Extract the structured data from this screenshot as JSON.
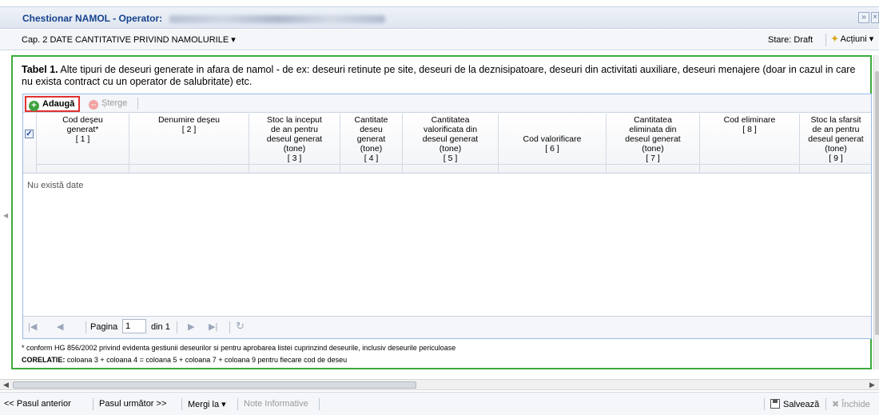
{
  "window": {
    "title_label": "Chestionar NAMOL - Operator:",
    "controls": {
      "collapse_icon": "double-chevron-up-icon",
      "close_icon": "close-icon"
    }
  },
  "chapter_bar": {
    "chapter_label": "Cap. 2 DATE CANTITATIVE PRIVIND NAMOLURILE ▾",
    "status_text": "Stare: Draft",
    "actions_label": "Acțiuni ▾"
  },
  "table": {
    "title_bold": "Tabel 1.",
    "title_text": " Alte tipuri de deseuri generate in afara de namol - de ex: deseuri retinute pe site, deseuri de la deznisipatoare, deseuri din activitati auxiliare, deseuri menajere (doar in cazul in care nu exista contract cu un operator de salubritate) etc.",
    "toolbar": {
      "add_label": "Adaugă",
      "delete_label": "Șterge"
    },
    "columns": [
      {
        "label": "Cod deşeu\ngenerat*",
        "num": "[ 1 ]"
      },
      {
        "label": "Denumire deşeu",
        "num": "[ 2 ]"
      },
      {
        "label": "Stoc la inceput\nde an pentru\ndeseul generat\n(tone)",
        "num": "[ 3 ]"
      },
      {
        "label": "Cantitate\ndeseu\ngenerat\n(tone)",
        "num": "[ 4 ]"
      },
      {
        "label": "Cantitatea\nvalorificata din\ndeseul generat\n(tone)",
        "num": "[ 5 ]"
      },
      {
        "label": "Cod valorificare",
        "num": "[ 6 ]"
      },
      {
        "label": "Cantitatea\neliminata din\ndeseul generat\n(tone)",
        "num": "[ 7 ]"
      },
      {
        "label": "Cod eliminare",
        "num": "[ 8 ]"
      },
      {
        "label": "Stoc la sfarsit\nde an pentru\ndeseul generat\n(tone)",
        "num": "[ 9 ]"
      }
    ],
    "empty_text": "Nu există date",
    "pager": {
      "page_label": "Pagina",
      "page_value": "1",
      "of_label": "din 1"
    },
    "footnote": "* conform HG 856/2002 privind evidenta gestiunii deseurilor si pentru aprobarea listei cuprinzind deseurile, inclusiv deseurile periculoase",
    "corelatie_label": "CORELATIE:",
    "corelatie_text": " coloana 3 + coloana 4 = coloana 5 + coloana 7 + coloana 9 pentru fiecare cod de deseu"
  },
  "bottom_bar": {
    "prev_label": "<< Pasul anterior",
    "next_label": "Pasul următor >>",
    "goto_label": "Mergi la ▾",
    "info_label": "Note Informative",
    "save_label": "Salvează",
    "close_label": "Închide"
  },
  "colors": {
    "accent_green": "#3cac3c",
    "highlight_red": "#e03030",
    "title_blue": "#15428b"
  }
}
